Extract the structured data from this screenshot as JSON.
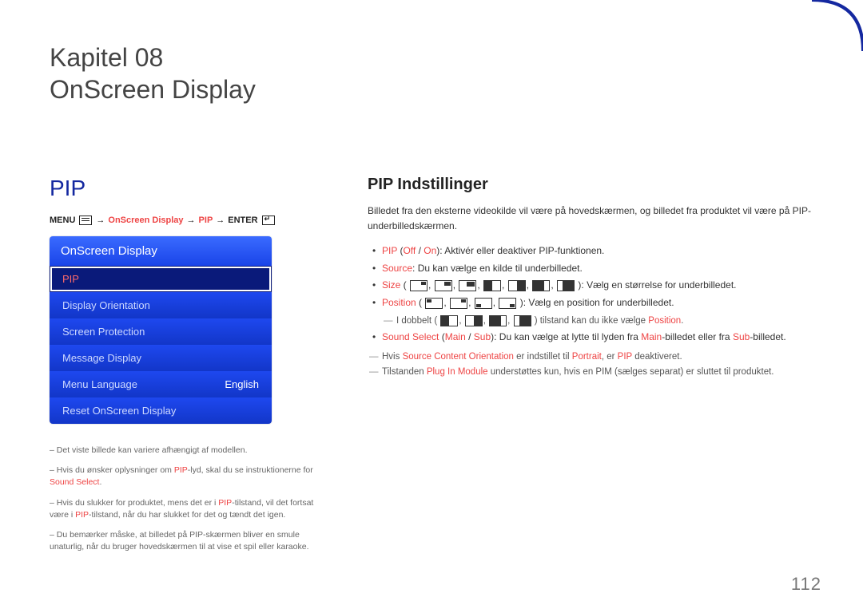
{
  "page_number": "112",
  "chapter": {
    "kapitel": "Kapitel 08",
    "title": "OnScreen Display"
  },
  "left": {
    "section_heading": "PIP",
    "breadcrumb": {
      "menu": "MENU",
      "p1": "OnScreen Display",
      "p2": "PIP",
      "enter": "ENTER"
    },
    "osd": {
      "header": "OnScreen Display",
      "items": [
        {
          "label": "PIP",
          "value": "",
          "selected": true
        },
        {
          "label": "Display Orientation",
          "value": "",
          "selected": false
        },
        {
          "label": "Screen Protection",
          "value": "",
          "selected": false
        },
        {
          "label": "Message Display",
          "value": "",
          "selected": false
        },
        {
          "label": "Menu Language",
          "value": "English",
          "selected": false
        },
        {
          "label": "Reset OnScreen Display",
          "value": "",
          "selected": false
        }
      ]
    },
    "footnotes": {
      "n1": "Det viste billede kan variere afhængigt af modellen.",
      "n2_pre": "Hvis du ønsker oplysninger om ",
      "n2_hl1": "PIP",
      "n2_mid": "-lyd, skal du se instruktionerne for ",
      "n2_hl2": "Sound Select",
      "n2_post": ".",
      "n3_pre": "Hvis du slukker for produktet, mens det er i ",
      "n3_hl1": "PIP",
      "n3_mid": "-tilstand, vil det fortsat være i ",
      "n3_hl2": "PIP",
      "n3_post": "-tilstand, når du har slukket for det og tændt det igen.",
      "n4": "Du bemærker måske, at billedet på PIP-skærmen bliver en smule unaturlig, når du bruger hovedskærmen til at vise et spil eller karaoke."
    }
  },
  "right": {
    "heading": "PIP Indstillinger",
    "intro": "Billedet fra den eksterne videokilde vil være på hovedskærmen, og billedet fra produktet vil være på PIP-underbilledskærmen.",
    "b1": {
      "hl": "PIP",
      "paren_off": "Off",
      "slash": " / ",
      "paren_on": "On",
      "rest": "): Aktivér eller deaktiver PIP-funktionen.",
      "open": " ("
    },
    "b2": {
      "hl": "Source",
      "rest": ": Du kan vælge en kilde til underbilledet."
    },
    "b3": {
      "hl": "Size",
      "open": " (",
      "rest": "): Vælg en størrelse for underbilledet."
    },
    "b4": {
      "hl": "Position",
      "open": " (",
      "rest": "): Vælg en position for underbilledet."
    },
    "b4_note_pre": "I dobbelt (",
    "b4_note_mid": ") tilstand kan du ikke vælge ",
    "b4_note_hl": "Position",
    "b4_note_post": ".",
    "b5": {
      "hl": "Sound Select",
      "open": " (",
      "opt1": "Main",
      "slash": " / ",
      "opt2": "Sub",
      "mid": "): Du kan vælge at lytte til lyden fra ",
      "m1": "Main",
      "mid2": "-billedet eller fra ",
      "m2": "Sub",
      "post": "-billedet."
    },
    "note2_pre": "Hvis ",
    "note2_hl1": "Source Content Orientation",
    "note2_mid": " er indstillet til ",
    "note2_hl2": "Portrait",
    "note2_mid2": ", er ",
    "note2_hl3": "PIP",
    "note2_post": " deaktiveret.",
    "note3_pre": "Tilstanden ",
    "note3_hl": "Plug In Module",
    "note3_post": " understøttes kun, hvis en PIM (sælges separat) er sluttet til produktet."
  }
}
